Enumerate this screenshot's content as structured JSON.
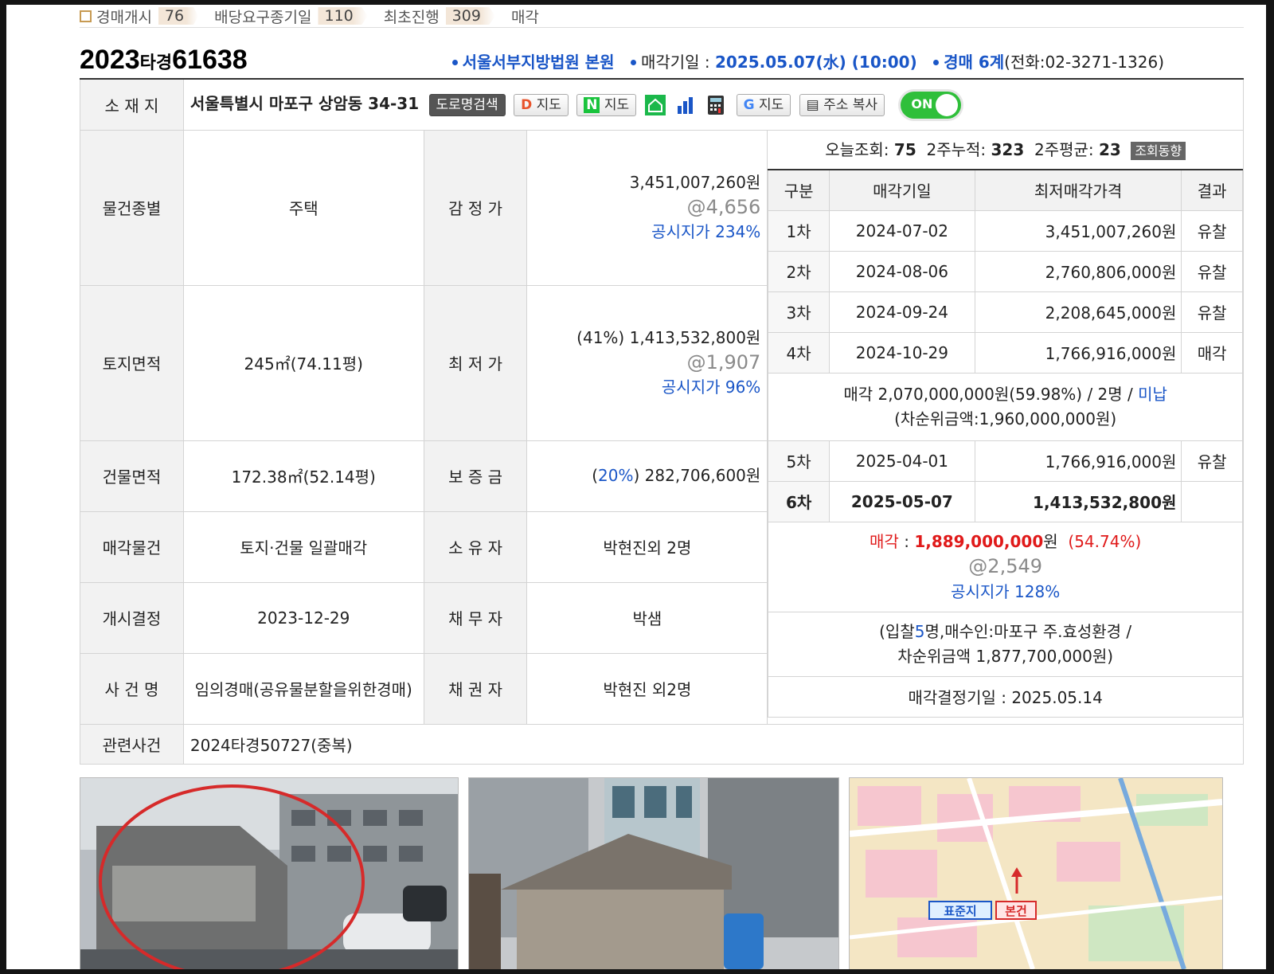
{
  "topbar": {
    "items": [
      {
        "label": "경매개시",
        "count": "76"
      },
      {
        "label": "배당요구종기일",
        "count": "110"
      },
      {
        "label": "최초진행",
        "count": "309"
      }
    ],
    "last": "매각"
  },
  "header": {
    "case_year": "2023",
    "case_type": "타경",
    "case_num": "61638",
    "court": "서울서부지방법원 본원",
    "sale_date_label": "매각기일 : ",
    "sale_date": "2025.05.07(水) (10:00)",
    "dept": "경매 6계",
    "phone": "(전화:02-3271-1326)"
  },
  "location": {
    "label": "소 재 지",
    "address": "서울특별시 마포구 상암동 34-31",
    "buttons": {
      "road": "도로명검색",
      "daum_map": "지도",
      "naver_map": "지도",
      "google_map": "지도",
      "copy": "주소 복사"
    },
    "toggle": "ON"
  },
  "details": {
    "type_label": "물건종별",
    "type_value": "주택",
    "appraisal_label": "감 정 가",
    "appraisal": "3,451,007,260원",
    "appraisal_unit": "@4,656",
    "appraisal_ratio": "공시지가 234%",
    "land_label": "토지면적",
    "land_value": "245㎡(74.11평)",
    "min_label": "최 저 가",
    "min_pct": "(41%)",
    "min_price": "1,413,532,800원",
    "min_unit": "@1,907",
    "min_ratio": "공시지가 96%",
    "bldg_label": "건물면적",
    "bldg_value": "172.38㎡(52.14평)",
    "deposit_label": "보 증 금",
    "deposit_pct": "20%",
    "deposit": "282,706,600원",
    "sale_obj_label": "매각물건",
    "sale_obj_value": "토지·건물 일괄매각",
    "owner_label": "소 유 자",
    "owner_value": "박현진외 2명",
    "start_label": "개시결정",
    "start_value": "2023-12-29",
    "debtor_label": "채 무 자",
    "debtor_value": "박샘",
    "case_label": "사 건 명",
    "case_value": "임의경매(공유물분할을위한경매)",
    "creditor_label": "채 권 자",
    "creditor_value": "박현진 외2명",
    "related_label": "관련사건",
    "related_value": "2024타경50727(중복)"
  },
  "stats": {
    "today_label": "오늘조회:",
    "today": "75",
    "twoweek_label": "2주누적:",
    "twoweek": "323",
    "avg_label": "2주평균:",
    "avg": "23",
    "trend_button": "조회동향"
  },
  "history": {
    "headers": [
      "구분",
      "매각기일",
      "최저매각가격",
      "결과"
    ],
    "rows": [
      {
        "round": "1차",
        "date": "2024-07-02",
        "price": "3,451,007,260원",
        "result": "유찰"
      },
      {
        "round": "2차",
        "date": "2024-08-06",
        "price": "2,760,806,000원",
        "result": "유찰"
      },
      {
        "round": "3차",
        "date": "2024-09-24",
        "price": "2,208,645,000원",
        "result": "유찰"
      },
      {
        "round": "4차",
        "date": "2024-10-29",
        "price": "1,766,916,000원",
        "result": "매각"
      }
    ],
    "note_main": "매각 2,070,000,000원(59.98%) / 2명 / ",
    "note_unpaid": "미납",
    "note_sub": "(차순위금액:1,960,000,000원)",
    "row5": {
      "round": "5차",
      "date": "2025-04-01",
      "price": "1,766,916,000원",
      "result": "유찰"
    },
    "row6": {
      "round": "6차",
      "date": "2025-05-07",
      "price": "1,413,532,800원",
      "result": ""
    },
    "final_label": "매각",
    "final_sep": " : ",
    "final_price": "1,889,000,000",
    "final_unit": "원",
    "final_pct": "(54.74%)",
    "final_per": "@2,549",
    "final_ratio": "공시지가 128%",
    "bid_pre": "(입찰",
    "bid_count": "5",
    "bid_post": "명,매수인:마포구 주.효성환경 /",
    "bid_line2": "차순위금액 1,877,700,000원)",
    "decision": "매각결정기일 : 2025.05.14"
  },
  "photos": {
    "map_label_standard": "표준지",
    "map_label_main": "본건"
  }
}
